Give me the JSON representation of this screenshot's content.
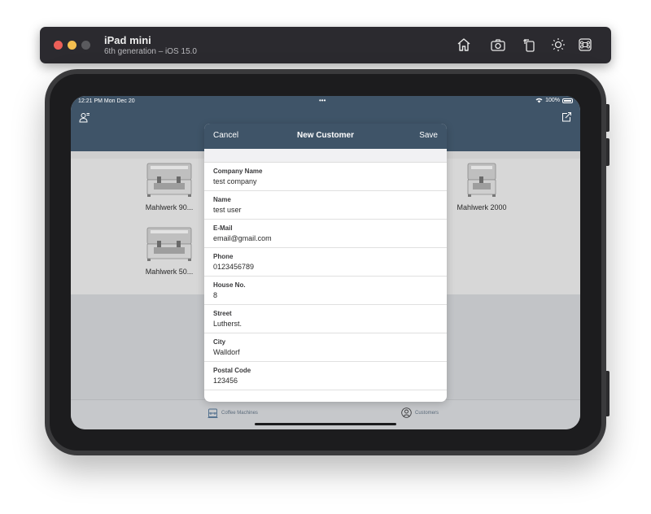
{
  "simulator": {
    "device_name": "iPad mini",
    "device_subtitle": "6th generation – iOS 15.0",
    "toolbar_icons": [
      "home-icon",
      "screenshot-icon",
      "rotate-icon",
      "appearance-icon",
      "keyboard-shortcut-icon"
    ]
  },
  "status_bar": {
    "time": "12:21 PM  Mon Dec 20",
    "dots": "•••",
    "battery": "100%"
  },
  "grid": {
    "machines": [
      {
        "label": "Mahlwerk 90..."
      },
      {
        "label": "Mahlwerk 2000"
      },
      {
        "label": "Mahlwerk 50..."
      }
    ]
  },
  "tabbar": {
    "tabs": [
      {
        "label": "Coffee Machines",
        "icon": "coffee-machine-icon"
      },
      {
        "label": "Customers",
        "icon": "person-circle-icon"
      }
    ]
  },
  "modal": {
    "cancel_label": "Cancel",
    "title": "New Customer",
    "save_label": "Save",
    "fields": [
      {
        "label": "Company Name",
        "value": "test company"
      },
      {
        "label": "Name",
        "value": "test user"
      },
      {
        "label": "E-Mail",
        "value": "email@gmail.com"
      },
      {
        "label": "Phone",
        "value": "0123456789"
      },
      {
        "label": "House No.",
        "value": "8"
      },
      {
        "label": "Street",
        "value": "Lutherst."
      },
      {
        "label": "City",
        "value": "Walldorf"
      },
      {
        "label": "Postal Code",
        "value": "123456"
      }
    ]
  },
  "colors": {
    "navbar": "#3f5468",
    "accent": "#3f5468"
  }
}
